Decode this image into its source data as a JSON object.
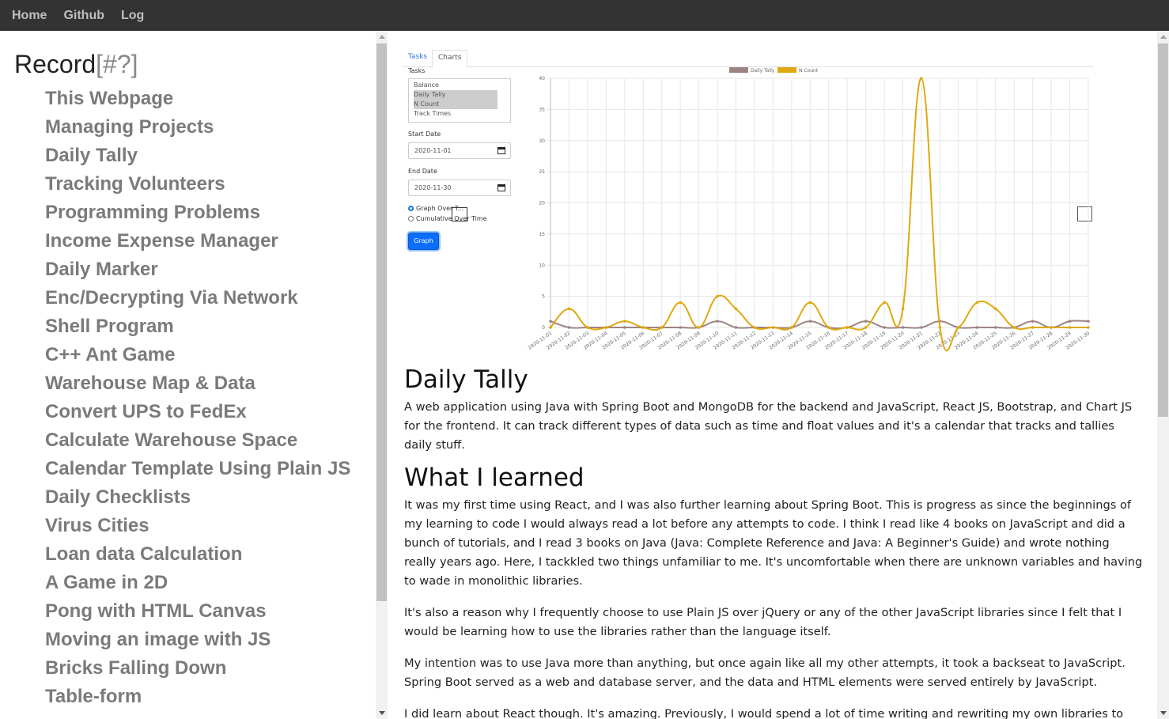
{
  "nav": {
    "items": [
      "Home",
      "Github",
      "Log"
    ]
  },
  "sidebar": {
    "title": "Record",
    "title_hint": "[#?]",
    "items": [
      "This Webpage",
      "Managing Projects",
      "Daily Tally",
      "Tracking Volunteers",
      "Programming Problems",
      "Income Expense Manager",
      "Daily Marker",
      "Enc/Decrypting Via Network",
      "Shell Program",
      "C++ Ant Game",
      "Warehouse Map & Data",
      "Convert UPS to FedEx",
      "Calculate Warehouse Space",
      "Calendar Template Using Plain JS",
      "Daily Checklists",
      "Virus Cities",
      "Loan data Calculation",
      "A Game in 2D",
      "Pong with HTML Canvas",
      "Moving an image with JS",
      "Bricks Falling Down",
      "Table-form"
    ]
  },
  "app": {
    "tabs": [
      "Tasks",
      "Charts"
    ],
    "tasks_label": "Tasks",
    "tasks_options": [
      "Balance",
      "Daily Tally",
      "N Count",
      "Track Times"
    ],
    "start_label": "Start Date",
    "start_value": "2020-11-01",
    "end_label": "End Date",
    "end_value": "2020-11-30",
    "radio_graph": "Graph Over T...",
    "radio_cumulative": "Cumulative Over Time",
    "graph_button": "Graph"
  },
  "chart_data": {
    "type": "line",
    "title": "",
    "legend_position": "top",
    "x": [
      "2020-11-01",
      "2020-11-02",
      "2020-11-03",
      "2020-11-04",
      "2020-11-05",
      "2020-11-06",
      "2020-11-07",
      "2020-11-08",
      "2020-11-09",
      "2020-11-10",
      "2020-11-11",
      "2020-11-12",
      "2020-11-13",
      "2020-11-14",
      "2020-11-15",
      "2020-11-16",
      "2020-11-17",
      "2020-11-18",
      "2020-11-19",
      "2020-11-20",
      "2020-11-21",
      "2020-11-22",
      "2020-11-23",
      "2020-11-24",
      "2020-11-25",
      "2020-11-26",
      "2020-11-27",
      "2020-11-28",
      "2020-11-29",
      "2020-11-30"
    ],
    "ylim": [
      0,
      40
    ],
    "yticks": [
      0,
      5,
      10,
      15,
      20,
      25,
      30,
      35,
      40
    ],
    "series": [
      {
        "name": "Daily Tally",
        "color": "#9e8383",
        "values": [
          1,
          0,
          0,
          0,
          0,
          0,
          0,
          0,
          0,
          1,
          0,
          0,
          0,
          0,
          1,
          0,
          0,
          1,
          0,
          0,
          0,
          1,
          0,
          0,
          0,
          0,
          1,
          0,
          1,
          1
        ]
      },
      {
        "name": "N Count",
        "color": "#e0a810",
        "values": [
          0,
          3,
          0,
          0,
          1,
          0,
          0,
          4,
          0,
          5,
          3,
          0,
          0,
          0,
          4,
          0,
          0,
          0,
          4,
          3,
          40,
          0,
          0,
          4,
          3,
          0,
          0,
          0,
          0,
          0
        ]
      }
    ]
  },
  "article": {
    "h1": "Daily Tally",
    "intro": "A web application using Java with Spring Boot and MongoDB for the backend and JavaScript, React JS, Bootstrap, and Chart JS for the frontend. It can track different types of data such as time and float values and it's a calendar that tracks and tallies daily stuff.",
    "h2": "What I learned",
    "p1": "It was my first time using React, and I was also further learning about Spring Boot. This is progress as since the beginnings of my learning to code I would always read a lot before any attempts to code. I think I read like 4 books on JavaScript and did a bunch of tutorials, and I read 3 books on Java (Java: Complete Reference and Java: A Beginner's Guide) and wrote nothing really years ago. Here, I tackkled two things unfamiliar to me. It's uncomfortable when there are unknown variables and having to wade in monolithic libraries.",
    "p2": "It's also a reason why I frequently choose to use Plain JS over jQuery or any of the other JavaScript libraries since I felt that I would be learning how to use the libraries rather than the language itself.",
    "p3": "My intention was to use Java more than anything, but once again like all my other attempts, it took a backseat to JavaScript. Spring Boot served as a web and database server, and the data and HTML elements were served entirely by JavaScript.",
    "p4": "I did learn about React though. It's amazing. Previously, I would spend a lot of time writing and rewriting my own libraries to"
  }
}
